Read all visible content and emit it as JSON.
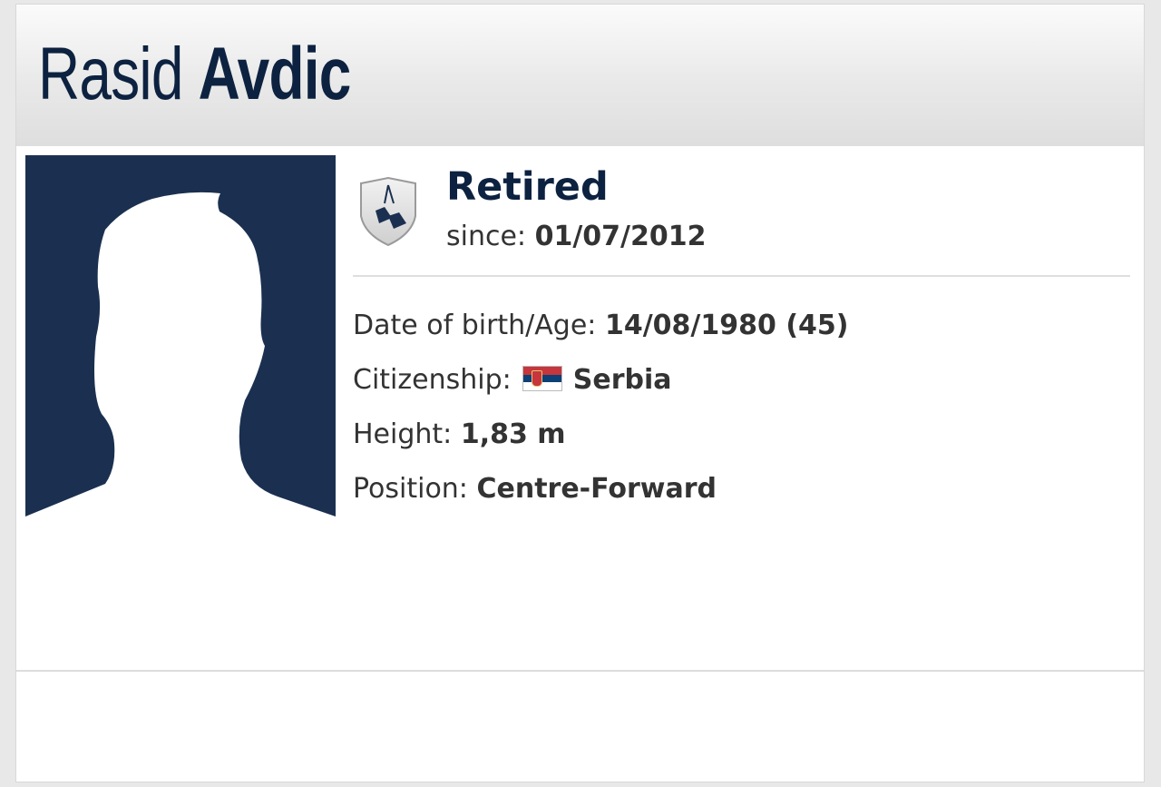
{
  "player": {
    "first_name": "Rasid",
    "last_name": "Avdic"
  },
  "status": {
    "label": "Retired",
    "since_label": "since:",
    "since_date": "01/07/2012",
    "icon": "retired-boots-icon"
  },
  "details": {
    "dob_label": "Date of birth/Age:",
    "dob_value": "14/08/1980 (45)",
    "citizenship_label": "Citizenship:",
    "citizenship_value": "Serbia",
    "citizenship_flag": "serbia-flag-icon",
    "height_label": "Height:",
    "height_value": "1,83 m",
    "position_label": "Position:",
    "position_value": "Centre-Forward"
  },
  "colors": {
    "brand_navy": "#0d2240",
    "photo_bg": "#1b3050"
  },
  "photo": {
    "icon": "player-silhouette-icon"
  }
}
